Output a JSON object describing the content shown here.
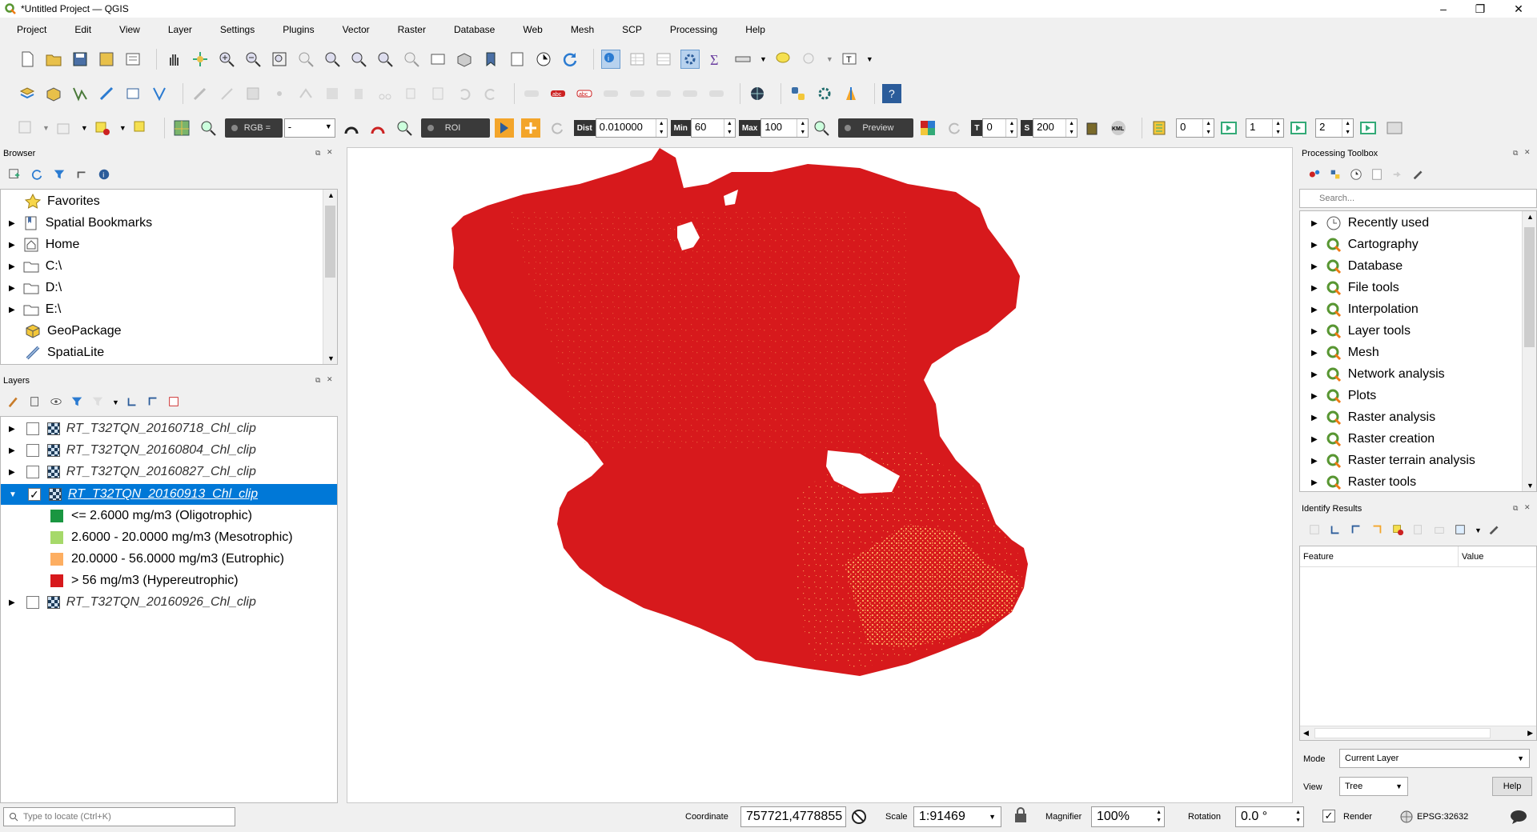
{
  "window": {
    "title": "*Untitled Project — QGIS"
  },
  "menu": [
    "Project",
    "Edit",
    "View",
    "Layer",
    "Settings",
    "Plugins",
    "Vector",
    "Raster",
    "Database",
    "Web",
    "Mesh",
    "SCP",
    "Processing",
    "Help"
  ],
  "scp_toolbar": {
    "rgb_label": "RGB =",
    "rgb_value": "-",
    "roi_label": "ROI",
    "dist_label": "Dist",
    "dist_value": "0.010000",
    "min_label": "Min",
    "min_value": "60",
    "max_label": "Max",
    "max_value": "100",
    "preview_label": "Preview",
    "t_label": "T",
    "t_value": "0",
    "s_label": "S",
    "s_value": "200",
    "kml_label": "KML",
    "band_value_1": "0",
    "band_value_2": "1",
    "band_value_3": "2"
  },
  "browser": {
    "title": "Browser",
    "items": [
      {
        "label": "Favorites",
        "icon": "star-icon",
        "expandable": false
      },
      {
        "label": "Spatial Bookmarks",
        "icon": "bookmark-icon",
        "expandable": true
      },
      {
        "label": "Home",
        "icon": "home-icon",
        "expandable": true
      },
      {
        "label": "C:\\",
        "icon": "folder-icon",
        "expandable": true
      },
      {
        "label": "D:\\",
        "icon": "folder-icon",
        "expandable": true
      },
      {
        "label": "E:\\",
        "icon": "folder-icon",
        "expandable": true
      },
      {
        "label": "GeoPackage",
        "icon": "geopackage-icon",
        "expandable": false
      },
      {
        "label": "SpatiaLite",
        "icon": "spatialite-icon",
        "expandable": false
      }
    ]
  },
  "layers": {
    "title": "Layers",
    "items": [
      {
        "name": "RT_T32TQN_20160718_Chl_clip",
        "checked": false,
        "selected": false
      },
      {
        "name": "RT_T32TQN_20160804_Chl_clip",
        "checked": false,
        "selected": false
      },
      {
        "name": "RT_T32TQN_20160827_Chl_clip",
        "checked": false,
        "selected": false
      },
      {
        "name": "RT_T32TQN_20160913_Chl_clip",
        "checked": true,
        "selected": true
      },
      {
        "name": "RT_T32TQN_20160926_Chl_clip",
        "checked": false,
        "selected": false
      }
    ],
    "legend": [
      {
        "label": "<= 2.6000 mg/m3 (Oligotrophic)",
        "color": "#1a9641"
      },
      {
        "label": "2.6000 - 20.0000 mg/m3 (Mesotrophic)",
        "color": "#a6d96a"
      },
      {
        "label": "20.0000 - 56.0000 mg/m3 (Eutrophic)",
        "color": "#fdae61"
      },
      {
        "label": "> 56 mg/m3 (Hypereutrophic)",
        "color": "#d7191c"
      }
    ]
  },
  "processing": {
    "title": "Processing Toolbox",
    "search_placeholder": "Search...",
    "items": [
      "Recently used",
      "Cartography",
      "Database",
      "File tools",
      "Interpolation",
      "Layer tools",
      "Mesh",
      "Network analysis",
      "Plots",
      "Raster analysis",
      "Raster creation",
      "Raster terrain analysis",
      "Raster tools"
    ]
  },
  "identify": {
    "title": "Identify Results",
    "col_feature": "Feature",
    "col_value": "Value",
    "mode_label": "Mode",
    "mode_value": "Current Layer",
    "view_label": "View",
    "view_value": "Tree",
    "help_label": "Help"
  },
  "status": {
    "locate_placeholder": "Type to locate (Ctrl+K)",
    "coordinate_label": "Coordinate",
    "coordinate_value": "757721,4778855",
    "scale_label": "Scale",
    "scale_value": "1:91469",
    "magnifier_label": "Magnifier",
    "magnifier_value": "100%",
    "rotation_label": "Rotation",
    "rotation_value": "0.0 °",
    "render_label": "Render",
    "crs_label": "EPSG:32632"
  },
  "colors": {
    "hypereutrophic": "#d7191c",
    "eutrophic": "#fdae61",
    "selection": "#0078d7"
  }
}
